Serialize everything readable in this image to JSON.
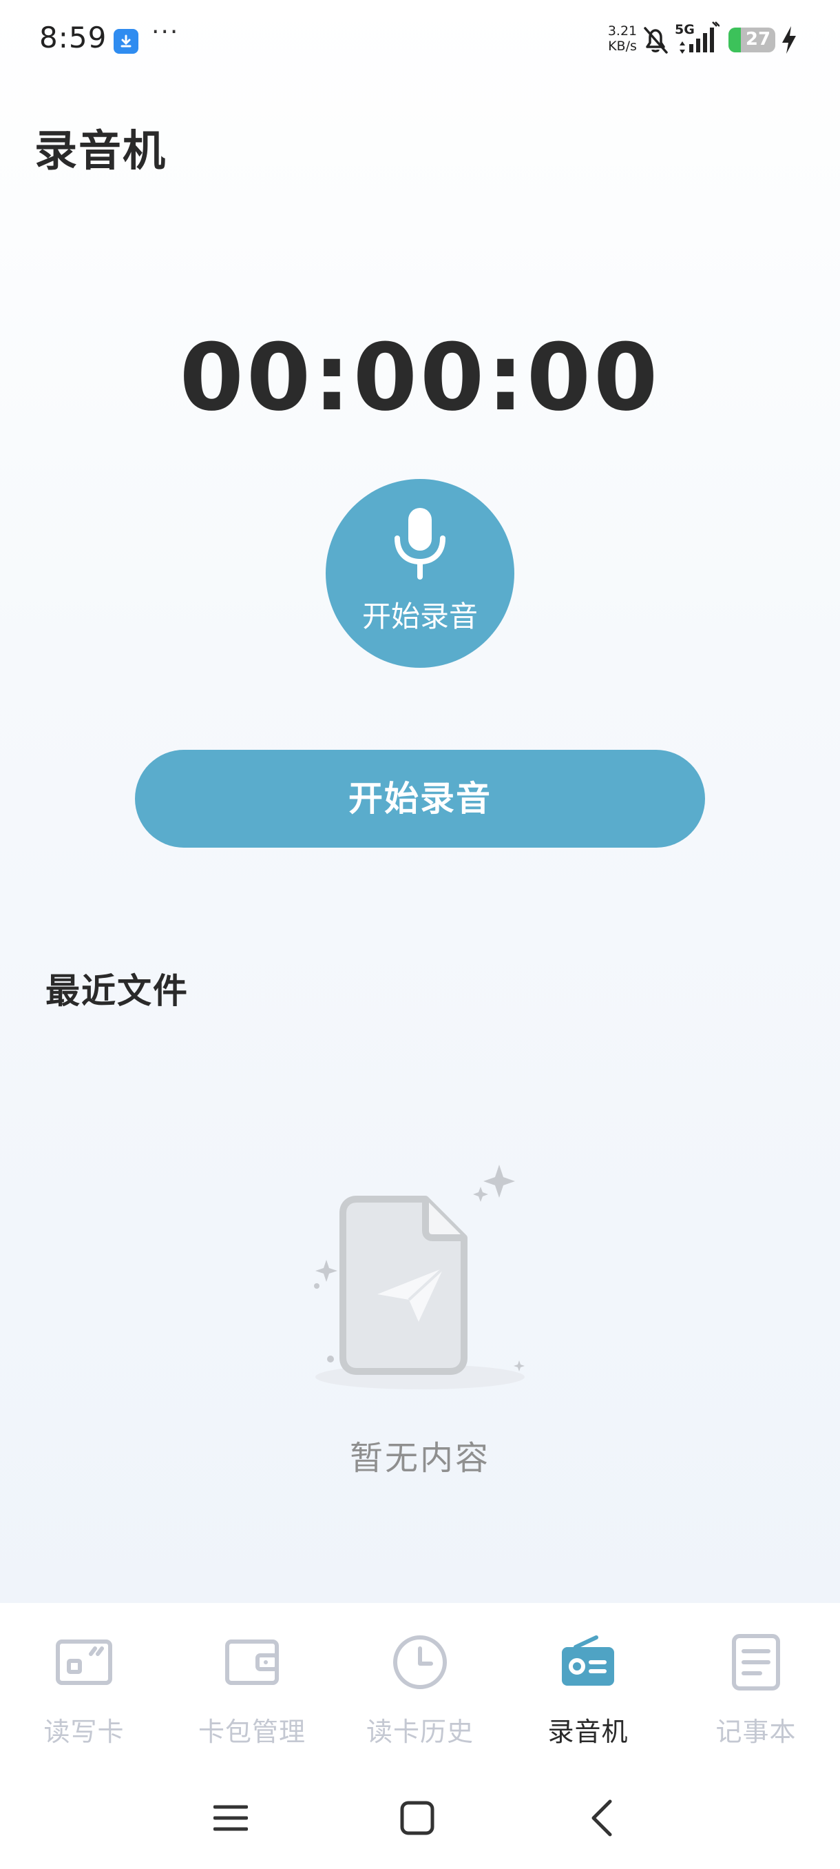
{
  "status_bar": {
    "time": "8:59",
    "dots": "···",
    "speed_value": "3.21",
    "speed_unit": "KB/s",
    "network": "5G",
    "battery": "27",
    "icons": [
      "download-icon",
      "bell-muted-icon",
      "signal-icon",
      "battery-icon",
      "charging-icon"
    ]
  },
  "page": {
    "title": "录音机"
  },
  "recorder": {
    "timer": "00:00:00",
    "circle_label": "开始录音",
    "pill_label": "开始录音",
    "accent": "#5aaccc"
  },
  "recent": {
    "title": "最近文件",
    "empty_text": "暂无内容"
  },
  "nav": {
    "items": [
      {
        "label": "读写卡",
        "icon": "card-reader-icon",
        "active": false
      },
      {
        "label": "卡包管理",
        "icon": "wallet-icon",
        "active": false
      },
      {
        "label": "读卡历史",
        "icon": "clock-icon",
        "active": false
      },
      {
        "label": "录音机",
        "icon": "radio-icon",
        "active": true
      },
      {
        "label": "记事本",
        "icon": "notepad-icon",
        "active": false
      }
    ],
    "inactive_color": "#c4c8d2",
    "active_color": "#5aaccc"
  },
  "system_nav": {
    "icons": [
      "menu-icon",
      "home-icon",
      "back-icon"
    ]
  }
}
